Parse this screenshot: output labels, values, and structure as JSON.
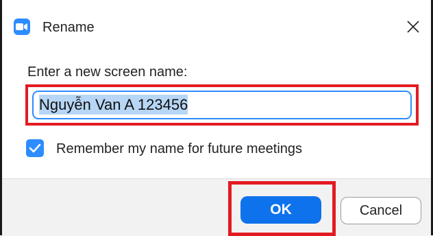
{
  "dialog": {
    "title": "Rename",
    "close_symbol": "×",
    "prompt": "Enter a new screen name:",
    "name_value": "Nguyễn Van A 123456",
    "remember_label": "Remember my name for future meetings",
    "remember_checked": true,
    "ok_label": "OK",
    "cancel_label": "Cancel"
  },
  "colors": {
    "accent": "#2d8cff",
    "primary_button": "#0e72ed",
    "highlight_annotation": "#e21b23",
    "footer_background": "#f2f2f2"
  },
  "icons": {
    "app_icon": "zoom-camera-icon",
    "close_icon": "close-icon",
    "checkbox_icon": "checkmark-icon"
  }
}
